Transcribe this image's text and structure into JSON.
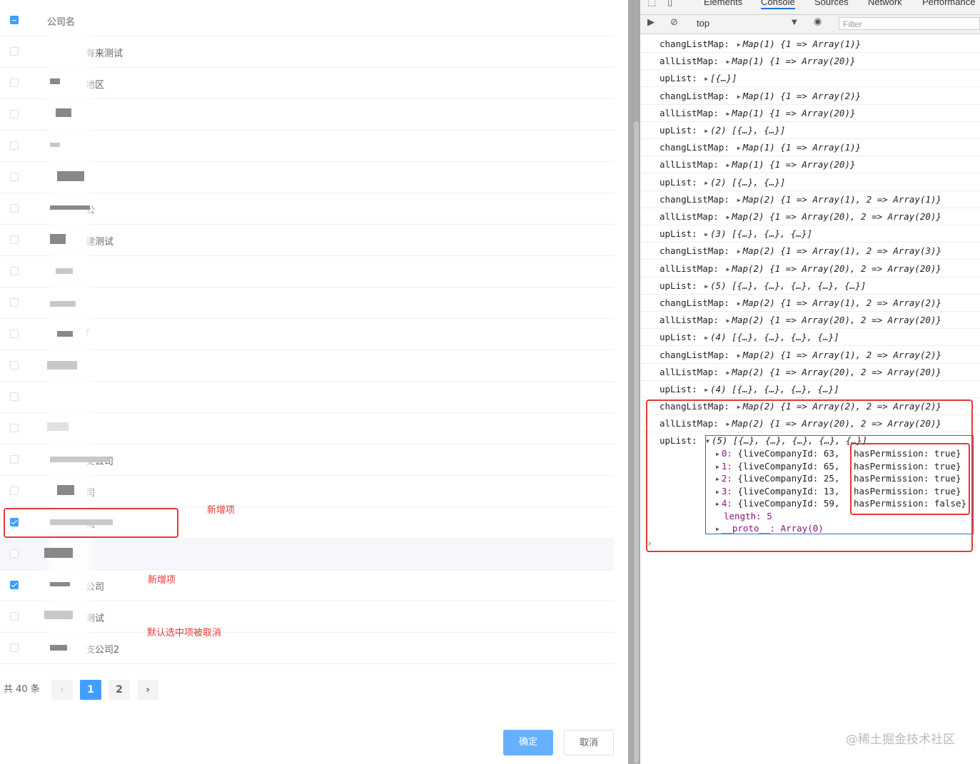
{
  "table": {
    "header": "公司名",
    "rows": [
      {
        "text": "公司名",
        "checked": false,
        "header": true
      },
      {
        "text": "有来测试"
      },
      {
        "text": "地区"
      },
      {
        "text": ""
      },
      {
        "text": ""
      },
      {
        "text": ""
      },
      {
        "text": "公"
      },
      {
        "text": "建测试"
      },
      {
        "text": ""
      },
      {
        "text": ""
      },
      {
        "text": "f"
      },
      {
        "text": ""
      },
      {
        "text": ""
      },
      {
        "text": ""
      },
      {
        "text": "支公司"
      },
      {
        "text": "司"
      },
      {
        "text": "司"
      },
      {
        "text": ""
      },
      {
        "text": "公司"
      },
      {
        "text": "测试"
      },
      {
        "text": "支公司2"
      }
    ],
    "row_texts": [
      "有来测试",
      "地区",
      "",
      "",
      "",
      "公",
      "建测试",
      "",
      "",
      "f",
      "",
      "",
      "",
      "支公司",
      "司",
      "司",
      "",
      "公司",
      "测试",
      "支公司2"
    ]
  },
  "annotations": {
    "added1": "新增项",
    "added2": "新增项",
    "cancelled": "默认选中项被取消"
  },
  "pagination": {
    "total": "共 40 条",
    "prev": "‹",
    "page1": "1",
    "page2": "2",
    "next": "›"
  },
  "buttons": {
    "ok": "确定",
    "cancel": "取消"
  },
  "devtools": {
    "tabs": [
      "Elements",
      "Console",
      "Sources",
      "Network",
      "Performance"
    ],
    "context": "top",
    "filter_placeholder": "Filter",
    "lines": [
      {
        "key": "changListMap:",
        "val": "Map(1) {1 => Array(1)}"
      },
      {
        "key": "allListMap:",
        "val": "Map(1) {1 => Array(20)}"
      },
      {
        "key": "upList:",
        "val": "[{…}]"
      },
      {
        "key": "changListMap:",
        "val": "Map(1) {1 => Array(2)}"
      },
      {
        "key": "allListMap:",
        "val": "Map(1) {1 => Array(20)}"
      },
      {
        "key": "upList:",
        "val": "(2) [{…}, {…}]"
      },
      {
        "key": "changListMap:",
        "val": "Map(1) {1 => Array(1)}"
      },
      {
        "key": "allListMap:",
        "val": "Map(1) {1 => Array(20)}"
      },
      {
        "key": "upList:",
        "val": "(2) [{…}, {…}]"
      },
      {
        "key": "changListMap:",
        "val": "Map(2) {1 => Array(1), 2 => Array(1)}"
      },
      {
        "key": "allListMap:",
        "val": "Map(2) {1 => Array(20), 2 => Array(20)}"
      },
      {
        "key": "upList:",
        "val": "(3) [{…}, {…}, {…}]"
      },
      {
        "key": "changListMap:",
        "val": "Map(2) {1 => Array(1), 2 => Array(3)}"
      },
      {
        "key": "allListMap:",
        "val": "Map(2) {1 => Array(20), 2 => Array(20)}"
      },
      {
        "key": "upList:",
        "val": "(5) [{…}, {…}, {…}, {…}, {…}]"
      },
      {
        "key": "changListMap:",
        "val": "Map(2) {1 => Array(1), 2 => Array(2)}"
      },
      {
        "key": "allListMap:",
        "val": "Map(2) {1 => Array(20), 2 => Array(20)}"
      },
      {
        "key": "upList:",
        "val": "(4) [{…}, {…}, {…}, {…}]"
      },
      {
        "key": "changListMap:",
        "val": "Map(2) {1 => Array(1), 2 => Array(2)}"
      },
      {
        "key": "allListMap:",
        "val": "Map(2) {1 => Array(20), 2 => Array(20)}"
      },
      {
        "key": "upList:",
        "val": "(4) [{…}, {…}, {…}, {…}]"
      },
      {
        "key": "changListMap:",
        "val": "Map(2) {1 => Array(2), 2 => Array(2)}"
      },
      {
        "key": "allListMap:",
        "val": "Map(2) {1 => Array(20), 2 => Array(20)}"
      }
    ],
    "last_uplist_key": "upList:",
    "last_uplist_val": "(5) [{…}, {…}, {…}, {…}, {…}]",
    "items": [
      {
        "idx": "0:",
        "id": "{liveCompanyId: 63,",
        "perm": "hasPermission: true}"
      },
      {
        "idx": "1:",
        "id": "{liveCompanyId: 65,",
        "perm": "hasPermission: true}"
      },
      {
        "idx": "2:",
        "id": "{liveCompanyId: 25,",
        "perm": "hasPermission: true}"
      },
      {
        "idx": "3:",
        "id": "{liveCompanyId: 13,",
        "perm": "hasPermission: true}"
      },
      {
        "idx": "4:",
        "id": "{liveCompanyId: 59,",
        "perm": "hasPermission: false}"
      }
    ],
    "length_line": "length: 5",
    "proto_line": "__proto__: Array(0)",
    "prompt": "›"
  },
  "watermark": "@稀土掘金技术社区",
  "colors": {
    "primary": "#409eff",
    "annotation_red": "#e53935",
    "devtools_blue": "#1a73e8"
  }
}
